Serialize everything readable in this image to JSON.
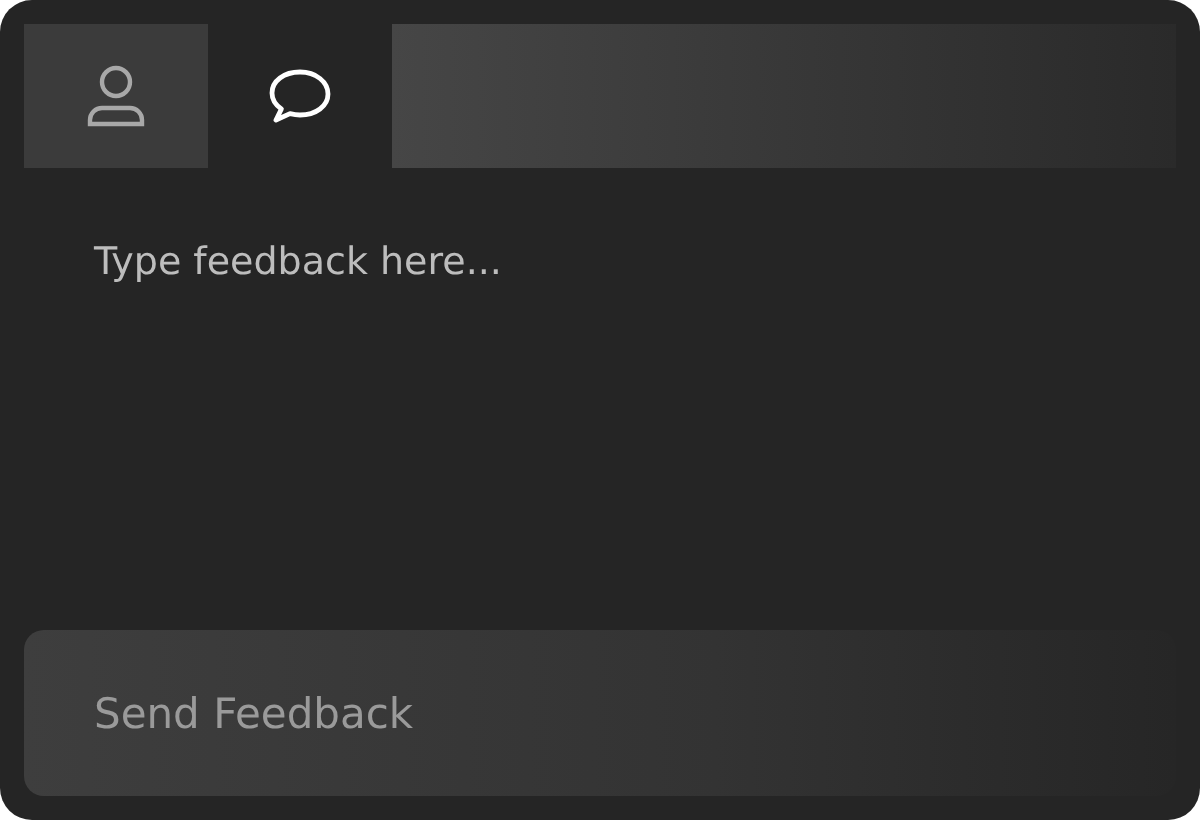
{
  "tabs": [
    {
      "kind": "person",
      "selected": false
    },
    {
      "kind": "chat",
      "selected": true
    }
  ],
  "feedback": {
    "placeholder": "Type feedback here..."
  },
  "send_button": {
    "label": "Send Feedback"
  }
}
